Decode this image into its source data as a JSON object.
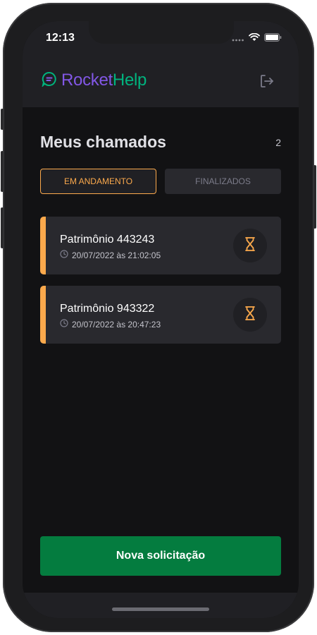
{
  "status_bar": {
    "time": "12:13"
  },
  "header": {
    "logo_part1": "Rocket",
    "logo_part2": "Help",
    "logo_icon": "chat-bubble-icon",
    "signout_icon": "sign-out-icon"
  },
  "main": {
    "title": "Meus chamados",
    "count": "2",
    "filters": [
      {
        "label": "EM ANDAMENTO",
        "active": true
      },
      {
        "label": "FINALIZADOS",
        "active": false
      }
    ],
    "tickets": [
      {
        "title": "Patrimônio 443243",
        "date": "20/07/2022 às 21:02:05",
        "status_icon": "hourglass-icon"
      },
      {
        "title": "Patrimônio 943322",
        "date": "20/07/2022 às 20:47:23",
        "status_icon": "hourglass-icon"
      }
    ],
    "new_button": "Nova solicitação"
  },
  "colors": {
    "background": "#121214",
    "header": "#202024",
    "card": "#29292e",
    "accent_orange": "#fba94c",
    "brand_purple": "#8257e5",
    "brand_green": "#00b37e",
    "button_green": "#047c3f"
  }
}
